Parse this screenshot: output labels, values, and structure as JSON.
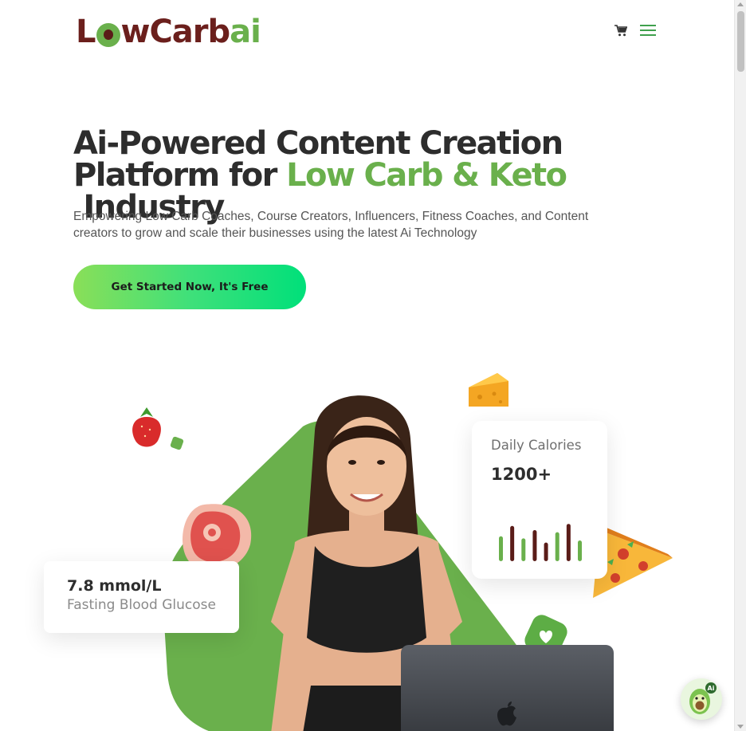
{
  "header": {
    "logo": {
      "part1": "L",
      "part2": "wCarb",
      "part3": "ai"
    },
    "cart_icon": "shopping-cart-icon",
    "menu_icon": "hamburger-menu-icon"
  },
  "hero": {
    "title_line1": "Ai-Powered Content Creation",
    "title_line2_start": "Platform for ",
    "title_highlight": "Low Carb & Keto",
    "title_line2_end": " Industry",
    "subtitle": "Empowering Low Carb Coaches, Course Creators, Influencers, Fitness Coaches, and Content creators to grow and scale their businesses using the latest Ai Technology",
    "cta_label": "Get Started Now, It's Free"
  },
  "cards": {
    "glucose": {
      "value": "7.8 mmol/L",
      "label": "Fasting Blood Glucose"
    },
    "calories": {
      "label": "Daily Calories",
      "value": "1200+",
      "bars": [
        {
          "level": 0.6,
          "color": "#6ab04c"
        },
        {
          "level": 0.85,
          "color": "#5a1c18"
        },
        {
          "level": 0.55,
          "color": "#6ab04c"
        },
        {
          "level": 0.75,
          "color": "#5a1c18"
        },
        {
          "level": 0.45,
          "color": "#5a1c18"
        },
        {
          "level": 0.7,
          "color": "#6ab04c"
        },
        {
          "level": 0.9,
          "color": "#5a1c18"
        },
        {
          "level": 0.5,
          "color": "#6ab04c"
        }
      ]
    }
  },
  "illustration": {
    "icons": [
      "strawberry-icon",
      "cheese-icon",
      "steak-icon",
      "pizza-icon",
      "heart-badge-icon",
      "apple-logo-icon"
    ],
    "accent_color": "#6ab04c",
    "brand_brown": "#6b1f1c"
  },
  "chat_widget": {
    "icon": "avocado-ai-icon"
  }
}
